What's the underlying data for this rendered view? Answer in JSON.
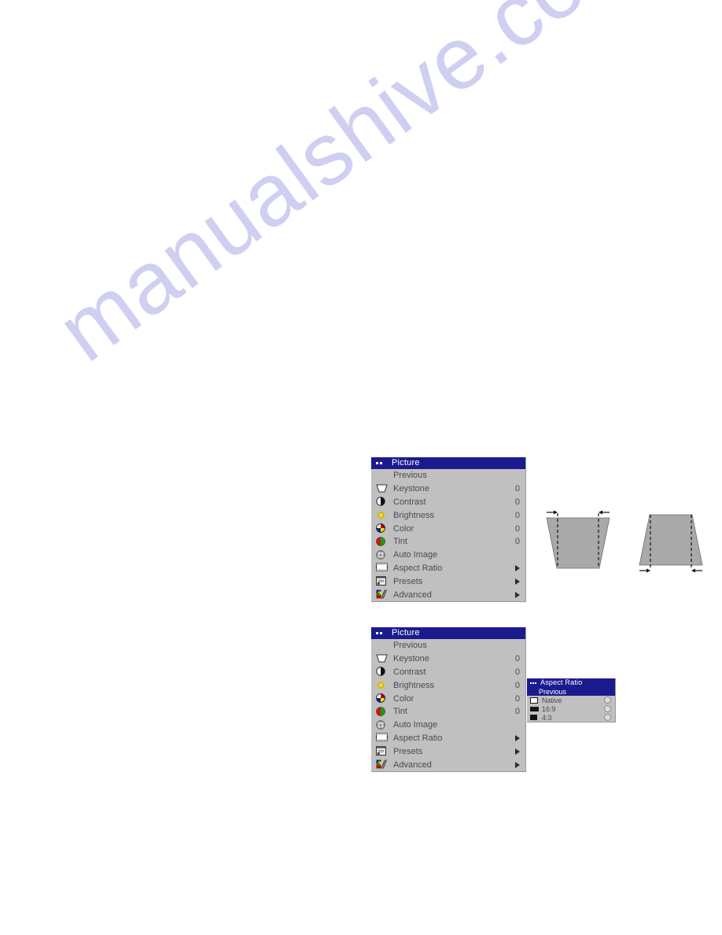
{
  "watermark": {
    "text": "manualshive.com"
  },
  "menus": [
    {
      "id": "picture-menu-top",
      "title": "Picture",
      "title_dots": 2,
      "items": [
        {
          "icon": "none-icon",
          "label": "Previous",
          "value": "",
          "arrow": false
        },
        {
          "icon": "keystone-icon",
          "label": "Keystone",
          "value": "0",
          "arrow": false
        },
        {
          "icon": "contrast-icon",
          "label": "Contrast",
          "value": "0",
          "arrow": false
        },
        {
          "icon": "brightness-icon",
          "label": "Brightness",
          "value": "0",
          "arrow": false
        },
        {
          "icon": "color-icon",
          "label": "Color",
          "value": "0",
          "arrow": false
        },
        {
          "icon": "tint-icon",
          "label": "Tint",
          "value": "0",
          "arrow": false
        },
        {
          "icon": "auto-image-icon",
          "label": "Auto Image",
          "value": "",
          "arrow": false
        },
        {
          "icon": "aspect-ratio-icon",
          "label": "Aspect Ratio",
          "value": "",
          "arrow": true
        },
        {
          "icon": "presets-icon",
          "label": "Presets",
          "value": "",
          "arrow": true
        },
        {
          "icon": "advanced-icon",
          "label": "Advanced",
          "value": "",
          "arrow": true
        }
      ]
    },
    {
      "id": "picture-menu-bottom",
      "title": "Picture",
      "title_dots": 2,
      "items": [
        {
          "icon": "none-icon",
          "label": "Previous",
          "value": "",
          "arrow": false
        },
        {
          "icon": "keystone-icon",
          "label": "Keystone",
          "value": "0",
          "arrow": false
        },
        {
          "icon": "contrast-icon",
          "label": "Contrast",
          "value": "0",
          "arrow": false
        },
        {
          "icon": "brightness-icon",
          "label": "Brightness",
          "value": "0",
          "arrow": false
        },
        {
          "icon": "color-icon",
          "label": "Color",
          "value": "0",
          "arrow": false
        },
        {
          "icon": "tint-icon",
          "label": "Tint",
          "value": "0",
          "arrow": false
        },
        {
          "icon": "auto-image-icon",
          "label": "Auto Image",
          "value": "",
          "arrow": false
        },
        {
          "icon": "aspect-ratio-icon",
          "label": "Aspect Ratio",
          "value": "",
          "arrow": true
        },
        {
          "icon": "presets-icon",
          "label": "Presets",
          "value": "",
          "arrow": true
        },
        {
          "icon": "advanced-icon",
          "label": "Advanced",
          "value": "",
          "arrow": true
        }
      ]
    }
  ],
  "submenu": {
    "title": "Aspect Ratio",
    "title_dots": 3,
    "highlight_label": "Previous",
    "options": [
      {
        "label": "Native",
        "chip": "outline",
        "selected": false
      },
      {
        "label": "16:9",
        "chip": "filled",
        "selected": false
      },
      {
        "label": "4:3",
        "chip": "filled",
        "selected": false
      }
    ]
  },
  "figures": {
    "left": {
      "name": "keystone-narrow-bottom"
    },
    "right": {
      "name": "keystone-narrow-top"
    }
  },
  "colors": {
    "title_bar": "#1b1b8f",
    "menu_bg": "#c0c0c0",
    "menu_text": "#4a4a52",
    "watermark": "#cfcff2",
    "figure_fill": "#a9a9a9"
  }
}
